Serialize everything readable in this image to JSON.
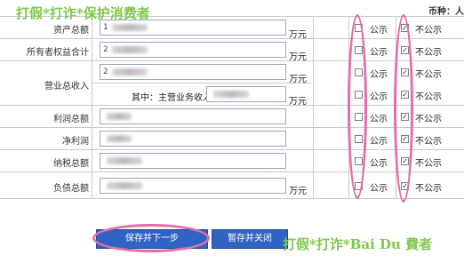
{
  "watermark_top": "打假*打诈*保护消费者",
  "watermark_bottom": "打假*打诈*Bai Du 費者",
  "header_fragment": "币种：人",
  "unit": "万元",
  "rows": [
    {
      "label": "资产总额",
      "value_prefix": "1"
    },
    {
      "label": "所有者权益合计",
      "value_prefix": "2"
    },
    {
      "label": "营业总收入",
      "value_prefix": "2"
    },
    {
      "label": "",
      "sub_label": "其中：主营业务收入",
      "value_prefix": ""
    },
    {
      "label": "利润总额",
      "value_prefix": ""
    },
    {
      "label": "净利润",
      "value_prefix": ""
    },
    {
      "label": "纳税总额",
      "value_prefix": ""
    },
    {
      "label": "负债总额",
      "value_prefix": ""
    }
  ],
  "options": {
    "public": "公示",
    "not_public": "不公示"
  },
  "public_checked": [
    false,
    false,
    false,
    false,
    false,
    false,
    false,
    false
  ],
  "not_public_checked": [
    true,
    true,
    true,
    true,
    true,
    true,
    true,
    true
  ],
  "buttons": {
    "save_next": "保存并下一步",
    "save_close": "暂存并关闭"
  },
  "colors": {
    "button_blue": "#2f63c4",
    "highlight_pink": "#e26fa6",
    "watermark_green": "#7ec84a"
  }
}
